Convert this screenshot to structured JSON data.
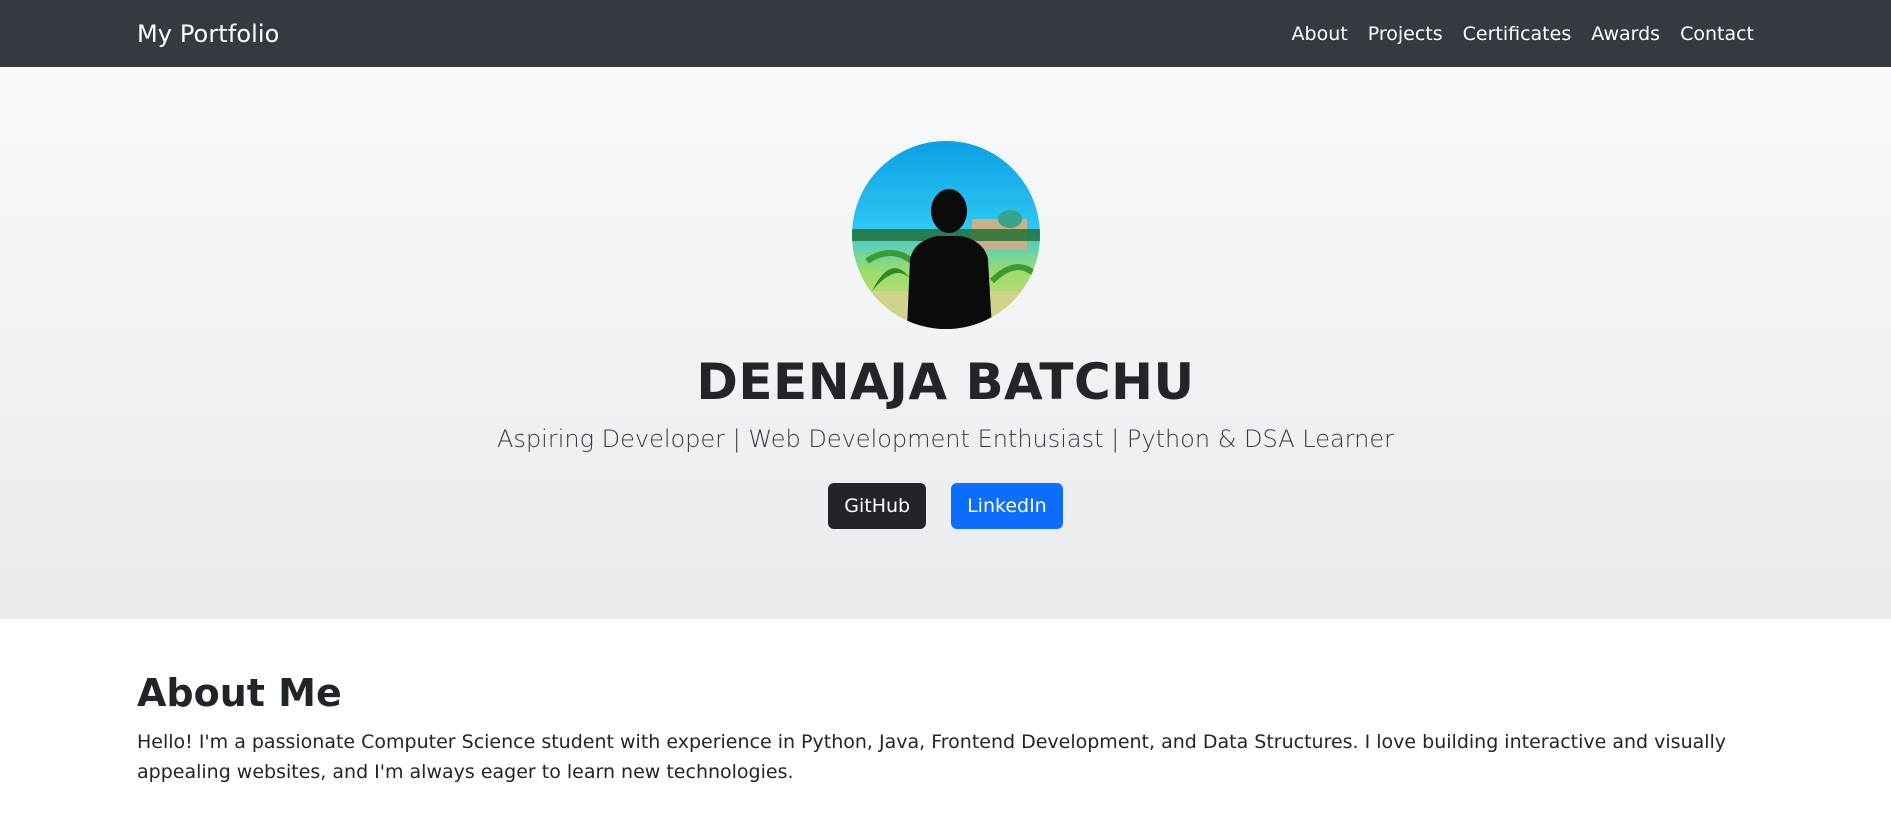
{
  "navbar": {
    "brand": "My Portfolio",
    "links": [
      "About",
      "Projects",
      "Certificates",
      "Awards",
      "Contact"
    ]
  },
  "hero": {
    "name": "DEENAJA BATCHU",
    "tagline": "Aspiring Developer | Web Development Enthusiast | Python & DSA Learner",
    "buttons": {
      "github": "GitHub",
      "linkedin": "LinkedIn"
    }
  },
  "about": {
    "heading": "About Me",
    "text": "Hello! I'm a passionate Computer Science student with experience in Python, Java, Frontend Development, and Data Structures. I love building interactive and visually appealing websites, and I'm always eager to learn new technologies."
  },
  "colors": {
    "navbar_bg": "#343a40",
    "primary": "#0d6efd",
    "dark": "#212529"
  }
}
